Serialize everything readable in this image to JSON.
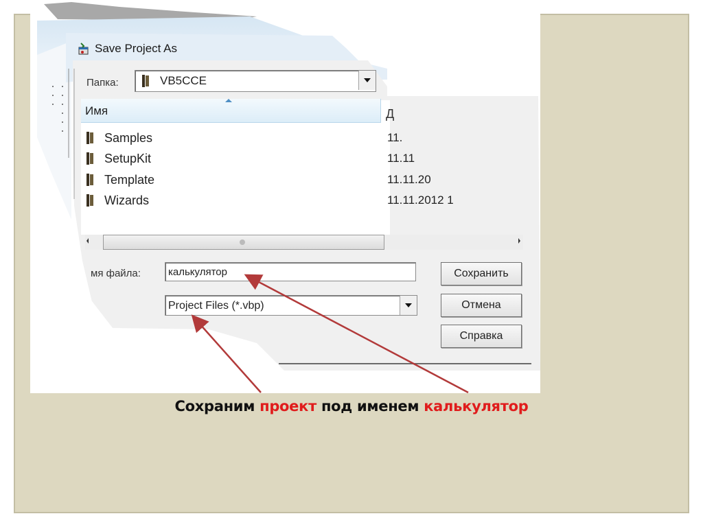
{
  "dialog": {
    "title": "Save Project As",
    "folder_label": "Папка:",
    "folder_value": "VB5CCE",
    "columns": [
      {
        "label": "Имя"
      },
      {
        "label": "Д"
      }
    ],
    "files": [
      {
        "name": "Samples",
        "date": "11."
      },
      {
        "name": "SetupKit",
        "date": "11.11"
      },
      {
        "name": "Template",
        "date": "11.11.20"
      },
      {
        "name": "Wizards",
        "date": "11.11.2012 1"
      }
    ],
    "filename_label": "мя файла:",
    "filename_value": "калькулятор",
    "filetype_label": "",
    "filetype_value": "Project Files (*.vbp)",
    "buttons": {
      "save": "Сохранить",
      "cancel": "Отмена",
      "help": "Справка"
    }
  },
  "caption": {
    "part1": "Сохраним ",
    "part2": "проект",
    "part3": " под именем ",
    "part4": "калькулятор"
  },
  "colors": {
    "slide_background": "#ddd8c0",
    "highlight": "#e01c1c",
    "arrow": "#b23a3a"
  }
}
